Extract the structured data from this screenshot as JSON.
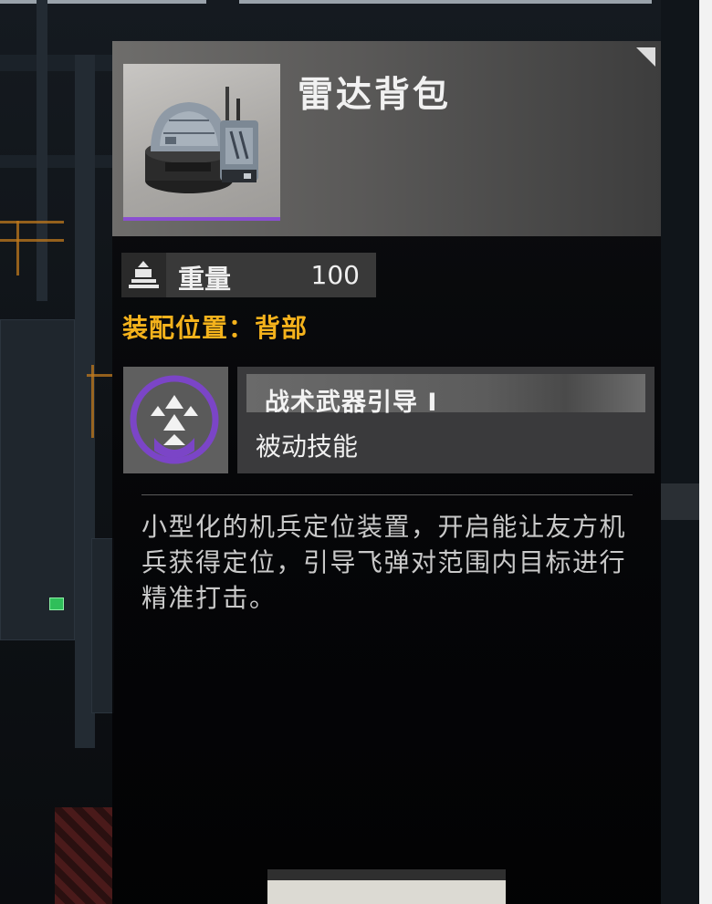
{
  "item": {
    "name": "雷达背包",
    "image_icon": "radar-backpack-icon",
    "rarity_color": "#8a4fd1"
  },
  "weight": {
    "icon": "weight-icon",
    "label": "重量",
    "value": "100"
  },
  "slot": {
    "text": "装配位置：背部",
    "color": "#f4b21c"
  },
  "skill": {
    "icon": "tactical-guidance-skill-icon",
    "name": "战术武器引导 I",
    "type": "被动技能",
    "icon_accent": "#7b45c7"
  },
  "description": "小型化的机兵定位装置，开启能让友方机兵获得定位，引导飞弹对范围内目标进行精准打击。"
}
